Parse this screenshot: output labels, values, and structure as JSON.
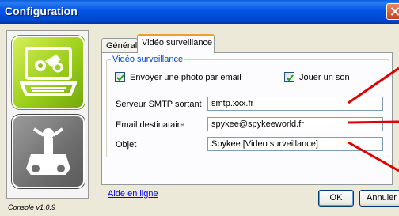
{
  "window": {
    "title": "Configuration"
  },
  "sidebar": {
    "version": "Console v1.0.9",
    "modes": [
      {
        "name": "video-surveillance",
        "icon": "laptop-robot-icon",
        "color": "#9ccf1a"
      },
      {
        "name": "robot",
        "icon": "robot-icon",
        "color": "#6e6e6e"
      }
    ]
  },
  "tabs": [
    {
      "label": "Général",
      "active": false
    },
    {
      "label": "Vidéo surveillance",
      "active": true
    }
  ],
  "group": {
    "title": "Vidéo surveillance",
    "send_photo": {
      "label": "Envoyer une photo par email",
      "checked": true
    },
    "play_sound": {
      "label": "Jouer un son",
      "checked": true
    }
  },
  "fields": {
    "smtp": {
      "label": "Serveur SMTP sortant",
      "value": "smtp.xxx.fr"
    },
    "email": {
      "label": "Email destinataire",
      "value": "spykee@spykeeworld.fr"
    },
    "subject": {
      "label": "Objet",
      "value": "Spykee [Video surveillance]"
    }
  },
  "footer": {
    "help_link": "Aide en ligne",
    "ok_label": "OK",
    "cancel_label": "Annuler"
  },
  "colors": {
    "accent": "#0054e3",
    "annotation": "#e00000",
    "link": "#0000ff",
    "group_title": "#0046d5"
  }
}
